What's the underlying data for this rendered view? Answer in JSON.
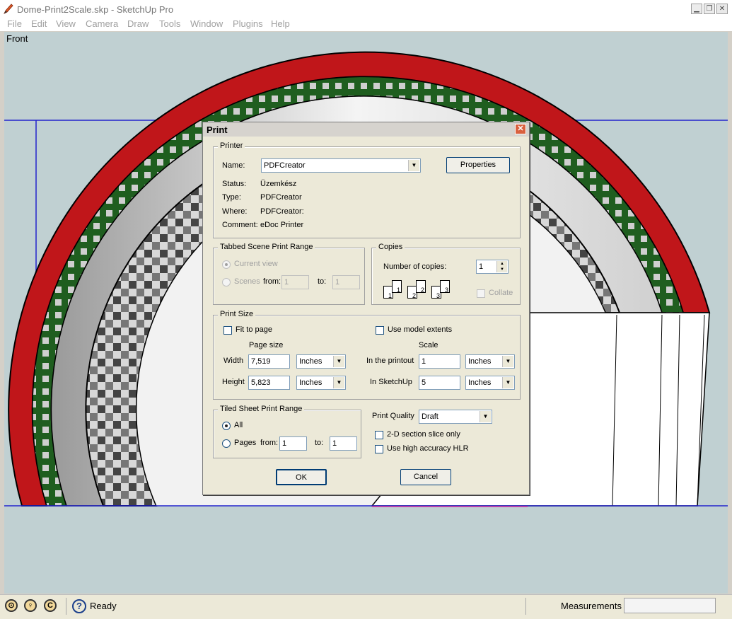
{
  "window": {
    "title": "Dome-Print2Scale.skp - SketchUp Pro"
  },
  "menu": [
    "File",
    "Edit",
    "View",
    "Camera",
    "Draw",
    "Tools",
    "Window",
    "Plugins",
    "Help"
  ],
  "viewport": {
    "scene_label": "Front"
  },
  "status": {
    "text": "Ready",
    "measurements_label": "Measurements",
    "measurements_value": ""
  },
  "dialog": {
    "title": "Print",
    "printer": {
      "legend": "Printer",
      "name_label": "Name:",
      "name_value": "PDFCreator",
      "properties_button": "Properties",
      "status_label": "Status:",
      "status_value": "Üzemkész",
      "type_label": "Type:",
      "type_value": "PDFCreator",
      "where_label": "Where:",
      "where_value": "PDFCreator:",
      "comment_label": "Comment:",
      "comment_value": "eDoc Printer"
    },
    "scene_range": {
      "legend": "Tabbed Scene Print Range",
      "current_view": "Current view",
      "scenes": "Scenes",
      "from_label": "from:",
      "from_value": "1",
      "to_label": "to:",
      "to_value": "1"
    },
    "copies": {
      "legend": "Copies",
      "number_label": "Number of copies:",
      "number_value": "1",
      "collate": "Collate",
      "page_icons": [
        "1",
        "1",
        "2",
        "2",
        "3",
        "3"
      ]
    },
    "print_size": {
      "legend": "Print Size",
      "fit_to_page": "Fit to page",
      "use_model_extents": "Use model extents",
      "page_size_header": "Page size",
      "scale_header": "Scale",
      "width_label": "Width",
      "width_value": "7,519",
      "width_unit": "Inches",
      "height_label": "Height",
      "height_value": "5,823",
      "height_unit": "Inches",
      "printout_label": "In the printout",
      "printout_value": "1",
      "printout_unit": "Inches",
      "sketchup_label": "In SketchUp",
      "sketchup_value": "5",
      "sketchup_unit": "Inches"
    },
    "tiled": {
      "legend": "Tiled Sheet Print Range",
      "all": "All",
      "pages": "Pages",
      "from_label": "from:",
      "from_value": "1",
      "to_label": "to:",
      "to_value": "1"
    },
    "quality": {
      "label": "Print Quality",
      "value": "Draft",
      "section_slice": "2-D section slice only",
      "high_accuracy": "Use high accuracy HLR"
    },
    "ok": "OK",
    "cancel": "Cancel"
  },
  "icons": [
    "sketchup-logo-icon",
    "minimize-icon",
    "maximize-icon",
    "close-icon",
    "dropdown-arrow-icon",
    "spin-icon",
    "help-icon",
    "geolocation-icon",
    "credits-icon",
    "copyright-icon"
  ]
}
